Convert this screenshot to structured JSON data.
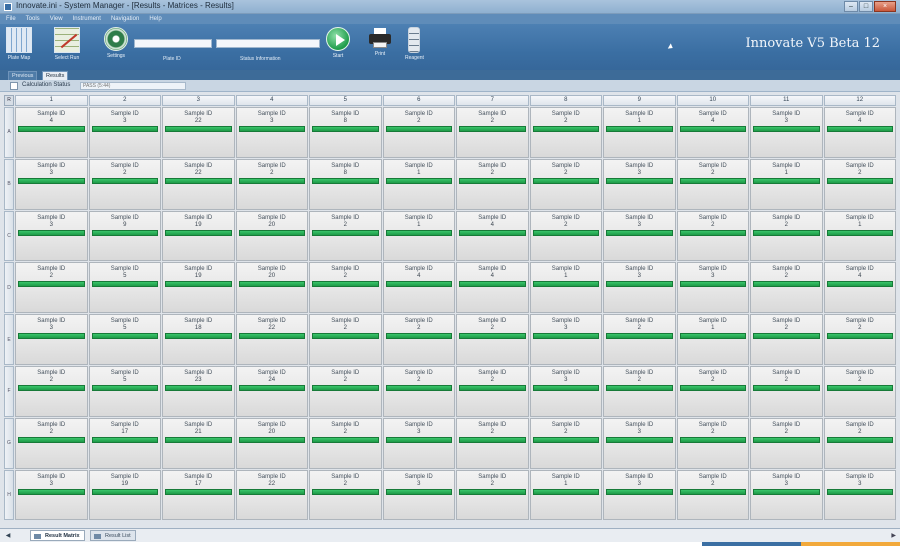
{
  "window": {
    "title": "Innovate.ini - System Manager - [Results - Matrices - Results]",
    "controls": [
      "–",
      "□",
      "×"
    ]
  },
  "menu": [
    "File",
    "Tools",
    "View",
    "Instrument",
    "Navigation",
    "Help"
  ],
  "ribbon": {
    "plate_map_label": "Plate Map",
    "select_run_label": "Select Run",
    "settings_label": "Settings",
    "plate_id_label": "Plate ID",
    "plate_id_value": "",
    "status_info_label": "Status Information",
    "status_info_value": "",
    "start_label": "Start",
    "print_label": "Print",
    "reagent_label": "Reagent",
    "brand": "Innovate V5 Beta 12"
  },
  "tabs": [
    "Previous",
    "Results"
  ],
  "calculation": {
    "label": "Calculation Status",
    "placeholder": "PASS (5:44)"
  },
  "grid": {
    "corner": "R",
    "columns": [
      "1",
      "2",
      "3",
      "4",
      "5",
      "6",
      "7",
      "8",
      "9",
      "10",
      "11",
      "12"
    ],
    "rows": [
      "A",
      "B",
      "C",
      "D",
      "E",
      "F",
      "G",
      "H"
    ],
    "cell_label": "Sample ID",
    "values": [
      [
        "4",
        "3",
        "22",
        "3",
        "8",
        "2",
        "2",
        "2",
        "1",
        "4",
        "3",
        "4"
      ],
      [
        "3",
        "2",
        "22",
        "2",
        "8",
        "1",
        "2",
        "2",
        "3",
        "2",
        "1",
        "2"
      ],
      [
        "3",
        "9",
        "19",
        "20",
        "2",
        "1",
        "4",
        "2",
        "3",
        "2",
        "2",
        "1"
      ],
      [
        "2",
        "5",
        "19",
        "20",
        "2",
        "4",
        "4",
        "1",
        "3",
        "3",
        "2",
        "4"
      ],
      [
        "3",
        "5",
        "18",
        "22",
        "2",
        "2",
        "2",
        "3",
        "2",
        "1",
        "2",
        "2"
      ],
      [
        "2",
        "5",
        "23",
        "24",
        "2",
        "2",
        "2",
        "3",
        "2",
        "2",
        "2",
        "2"
      ],
      [
        "2",
        "17",
        "21",
        "20",
        "2",
        "3",
        "2",
        "2",
        "3",
        "2",
        "2",
        "2"
      ],
      [
        "3",
        "19",
        "17",
        "22",
        "2",
        "3",
        "2",
        "1",
        "3",
        "2",
        "3",
        "3"
      ]
    ]
  },
  "sheets": {
    "tabs": [
      "Result Matrix",
      "Result List"
    ],
    "active": "Result Matrix"
  },
  "colors": {
    "ribbon": "#3b6fa3",
    "status_bar_green": "#1e9a48",
    "cell_bg": "#e6e6e6"
  }
}
